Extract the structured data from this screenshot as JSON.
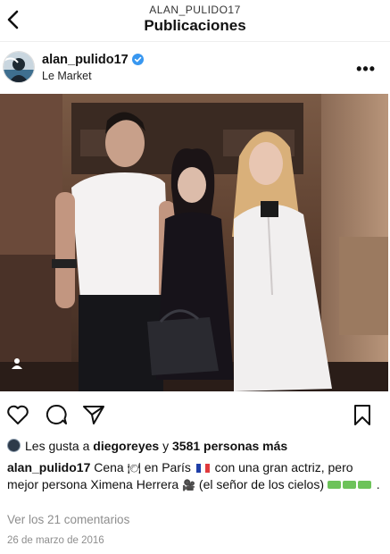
{
  "header": {
    "username": "ALAN_PULIDO17",
    "title": "Publicaciones"
  },
  "post": {
    "username": "alan_pulido17",
    "location": "Le Market",
    "more_label": "•••",
    "likes": {
      "prefix": "Les gusta a ",
      "user": "diegoreyes",
      "connector": " y ",
      "count_text": "3581 personas más"
    },
    "caption": {
      "username": "alan_pulido17",
      "text_1": " Cena ",
      "emoji_plate": "🍽",
      "text_2": " en París ",
      "text_3": " con una gran actriz, pero mejor persona Ximena Herrera ",
      "emoji_camera": "🎥",
      "text_4": " (el señor de los cielos) ",
      "text_5": " ."
    },
    "comments_link": "Ver los 21 comentarios",
    "date": "26 de marzo de 2016"
  },
  "icons": [
    "back-arrow-icon",
    "verified-badge-icon",
    "more-options-icon",
    "tag-people-icon",
    "heart-icon",
    "comment-icon",
    "share-icon",
    "bookmark-icon",
    "france-flag-icon",
    "water-gun-icon"
  ],
  "colors": {
    "verified": "#3897f0",
    "muted_text": "#8e8e8e",
    "flag_blue": "#1f3fa8",
    "flag_red": "#e03a3e",
    "gun_green": "#6dc35a"
  }
}
